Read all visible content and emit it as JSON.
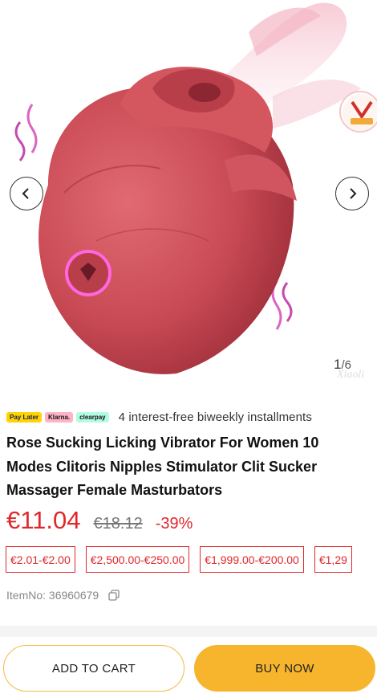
{
  "gallery": {
    "counter_current": "1",
    "counter_total": "/6",
    "prev_icon": "chevron-left-icon",
    "next_icon": "chevron-right-icon"
  },
  "payment": {
    "logos": [
      "Pay Later",
      "Klarna.",
      "clearpay"
    ],
    "text": "4 interest-free biweekly installments"
  },
  "product": {
    "title_line1": "Rose Sucking Licking Vibrator For Women 10",
    "title_line2": "Modes Clitoris Nipples Stimulator Clit Sucker",
    "title_line3": "Massager Female Masturbators",
    "price": "€11.04",
    "old_price": "€18.12",
    "discount": "-39%",
    "price_chips": [
      "€2.01-€2.00",
      "€2,500.00-€250.00",
      "€1,999.00-€200.00",
      "€1,29"
    ],
    "item_no": "ItemNo: 36960679"
  },
  "actions": {
    "add_to_cart": "ADD TO CART",
    "buy_now": "BUY NOW"
  },
  "colors": {
    "price_red": "#e0282c",
    "buy_yellow": "#f7b52e",
    "product_rose": "#c94a55"
  }
}
